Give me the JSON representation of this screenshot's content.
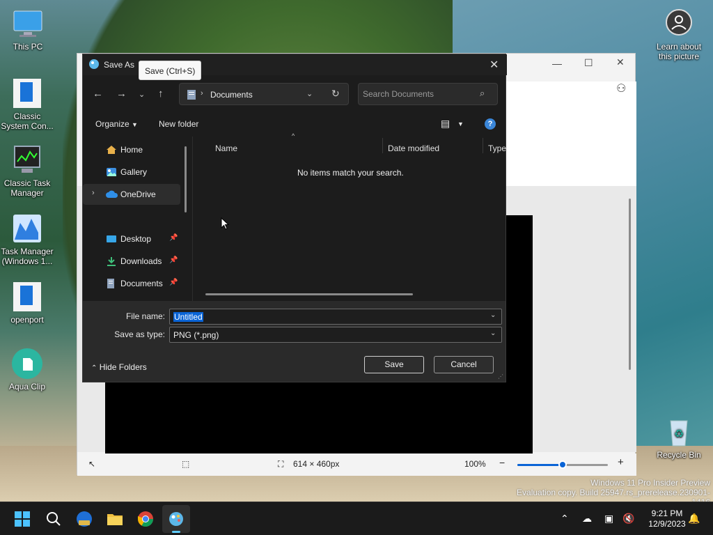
{
  "desktop": {
    "icons": [
      {
        "label": "This PC"
      },
      {
        "label": "Classic System Con..."
      },
      {
        "label": "Classic Task Manager"
      },
      {
        "label": "Task Manager (Windows 1..."
      },
      {
        "label": "openport"
      },
      {
        "label": "Aqua Clip"
      },
      {
        "label": "Learn about this picture"
      },
      {
        "label": "Recycle Bin"
      }
    ],
    "watermark_line1": "Windows 11 Pro Insider Preview",
    "watermark_line2": "Evaluation copy. Build 25947.rs_prerelease.230901-1416"
  },
  "paint": {
    "status": {
      "size": "614 × 460px",
      "zoom": "100%"
    },
    "zoom_fraction": 0.5
  },
  "dialog": {
    "title": "Save As",
    "tooltip": "Save (Ctrl+S)",
    "address": {
      "current": "Documents"
    },
    "search": {
      "placeholder": "Search Documents",
      "value": ""
    },
    "commands": {
      "organize": "Organize",
      "new_folder": "New folder"
    },
    "nav_items": [
      {
        "label": "Home"
      },
      {
        "label": "Gallery"
      },
      {
        "label": "OneDrive"
      },
      {
        "label": "Desktop"
      },
      {
        "label": "Downloads"
      },
      {
        "label": "Documents"
      }
    ],
    "columns": {
      "name": "Name",
      "date_modified": "Date modified",
      "type": "Type"
    },
    "empty_message": "No items match your search.",
    "file_name_label": "File name:",
    "file_name_value": "Untitled",
    "save_type_label": "Save as type:",
    "save_type_value": "PNG (*.png)",
    "save_button": "Save",
    "cancel_button": "Cancel",
    "hide_folders": "Hide Folders"
  },
  "taskbar": {
    "time": "9:21 PM",
    "date": "12/9/2023"
  },
  "colors": {
    "accent": "#0a64d6",
    "dialog_bg": "#1c1c1c",
    "taskbar_bg": "#1b1b1b"
  }
}
